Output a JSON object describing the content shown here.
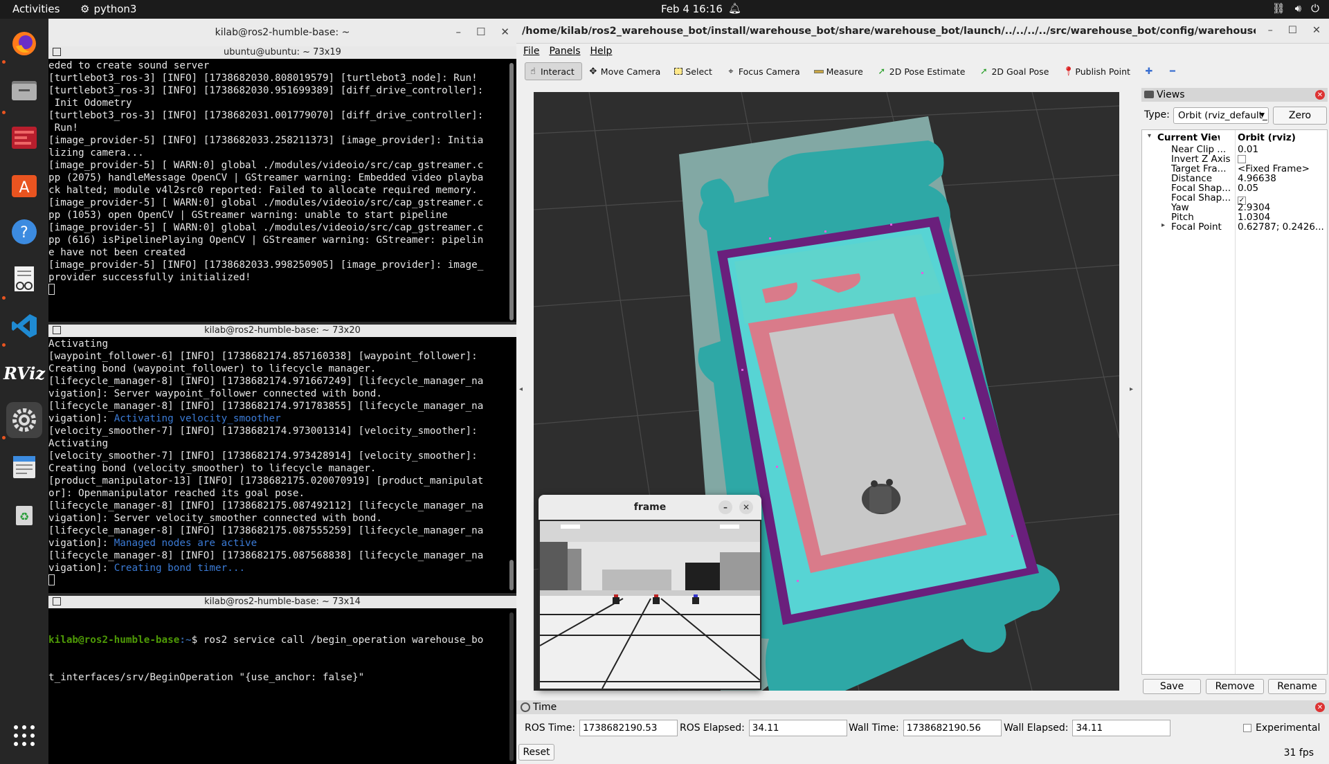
{
  "topbar": {
    "activities": "Activities",
    "app": "python3",
    "clock": "Feb 4  16:16"
  },
  "dock": {
    "items": [
      "firefox-icon",
      "files-icon",
      "terminal-icon",
      "software-icon",
      "help-icon",
      "text-editor-icon",
      "vscode-icon",
      "rviz-icon",
      "settings-icon",
      "notes-icon",
      "trash-icon",
      "app-grid-icon"
    ],
    "rviz_label": "RViz"
  },
  "terminals": {
    "window_title": "kilab@ros2-humble-base: ~",
    "panes": [
      {
        "tab": "ubuntu@ubuntu: ~ 73x19",
        "lines": [
          "eded to create sound server",
          "[turtlebot3_ros-3] [INFO] [1738682030.808019579] [turtlebot3_node]: Run!",
          "[turtlebot3_ros-3] [INFO] [1738682030.951699389] [diff_drive_controller]:",
          " Init Odometry",
          "[turtlebot3_ros-3] [INFO] [1738682031.001779070] [diff_drive_controller]:",
          " Run!",
          "[image_provider-5] [INFO] [1738682033.258211373] [image_provider]: Initia",
          "lizing camera...",
          "[image_provider-5] [ WARN:0] global ./modules/videoio/src/cap_gstreamer.c",
          "pp (2075) handleMessage OpenCV | GStreamer warning: Embedded video playba",
          "ck halted; module v4l2src0 reported: Failed to allocate required memory.",
          "[image_provider-5] [ WARN:0] global ./modules/videoio/src/cap_gstreamer.c",
          "pp (1053) open OpenCV | GStreamer warning: unable to start pipeline",
          "[image_provider-5] [ WARN:0] global ./modules/videoio/src/cap_gstreamer.c",
          "pp (616) isPipelinePlaying OpenCV | GStreamer warning: GStreamer: pipelin",
          "e have not been created",
          "[image_provider-5] [INFO] [1738682033.998250905] [image_provider]: image_",
          "provider successfully initialized!"
        ]
      },
      {
        "tab": "kilab@ros2-humble-base: ~ 73x20",
        "lines": [
          {
            "t": "Activating"
          },
          {
            "t": "[waypoint_follower-6] [INFO] [1738682174.857160338] [waypoint_follower]:"
          },
          {
            "t": "Creating bond (waypoint_follower) to lifecycle manager."
          },
          {
            "t": "[lifecycle_manager-8] [INFO] [1738682174.971667249] [lifecycle_manager_na"
          },
          {
            "t": "vigation]: Server waypoint_follower connected with bond."
          },
          {
            "t": "[lifecycle_manager-8] [INFO] [1738682174.971783855] [lifecycle_manager_na"
          },
          {
            "t": "vigation]: ",
            "h": "Activating velocity_smoother"
          },
          {
            "t": "[velocity_smoother-7] [INFO] [1738682174.973001314] [velocity_smoother]:"
          },
          {
            "t": "Activating"
          },
          {
            "t": "[velocity_smoother-7] [INFO] [1738682174.973428914] [velocity_smoother]:"
          },
          {
            "t": "Creating bond (velocity_smoother) to lifecycle manager."
          },
          {
            "t": "[product_manipulator-13] [INFO] [1738682175.020070919] [product_manipulat"
          },
          {
            "t": "or]: Openmanipulator reached its goal pose."
          },
          {
            "t": "[lifecycle_manager-8] [INFO] [1738682175.087492112] [lifecycle_manager_na"
          },
          {
            "t": "vigation]: Server velocity_smoother connected with bond."
          },
          {
            "t": "[lifecycle_manager-8] [INFO] [1738682175.087555259] [lifecycle_manager_na"
          },
          {
            "t": "vigation]: ",
            "h": "Managed nodes are active"
          },
          {
            "t": "[lifecycle_manager-8] [INFO] [1738682175.087568838] [lifecycle_manager_na"
          },
          {
            "t": "vigation]: ",
            "h": "Creating bond timer..."
          }
        ]
      },
      {
        "tab": "kilab@ros2-humble-base: ~ 73x14",
        "prompt_user": "kilab@ros2-humble-base",
        "prompt_path": ":~",
        "prompt_sym": "$ ",
        "cmd1": "ros2 service call /begin_operation warehouse_bo",
        "cmd2": "t_interfaces/srv/BeginOperation \"{use_anchor: false}\""
      }
    ]
  },
  "rviz": {
    "title": "/home/kilab/ros2_warehouse_bot/install/warehouse_bot/share/warehouse_bot/launch/../../../../src/warehouse_bot/config/warehouse_bot_defaul...",
    "menu": [
      "File",
      "Panels",
      "Help"
    ],
    "tools": [
      "Interact",
      "Move Camera",
      "Select",
      "Focus Camera",
      "Measure",
      "2D Pose Estimate",
      "2D Goal Pose",
      "Publish Point"
    ],
    "views": {
      "header": "Views",
      "type_label": "Type:",
      "type_value": "Orbit (rviz_default_plugins)",
      "zero": "Zero",
      "current_view": "Current View",
      "current_view_value": "Orbit (rviz)",
      "props": [
        {
          "k": "Near Clip ...",
          "v": "0.01"
        },
        {
          "k": "Invert Z Axis",
          "v": "",
          "check": false
        },
        {
          "k": "Target Fra...",
          "v": "<Fixed Frame>"
        },
        {
          "k": "Distance",
          "v": "4.96638"
        },
        {
          "k": "Focal Shap...",
          "v": "0.05"
        },
        {
          "k": "Focal Shap...",
          "v": "",
          "check": true
        },
        {
          "k": "Yaw",
          "v": "2.9304"
        },
        {
          "k": "Pitch",
          "v": "1.0304"
        },
        {
          "k": "Focal Point",
          "v": "0.62787; 0.2426...",
          "expand": true
        }
      ],
      "save": "Save",
      "remove": "Remove",
      "rename": "Rename"
    },
    "time": {
      "header": "Time",
      "ros_time_label": "ROS Time:",
      "ros_time": "1738682190.53",
      "ros_elapsed_label": "ROS Elapsed:",
      "ros_elapsed": "34.11",
      "wall_time_label": "Wall Time:",
      "wall_time": "1738682190.56",
      "wall_elapsed_label": "Wall Elapsed:",
      "wall_elapsed": "34.11",
      "experimental": "Experimental",
      "reset": "Reset",
      "fps": "31 fps"
    },
    "frame_window": {
      "title": "frame"
    }
  }
}
